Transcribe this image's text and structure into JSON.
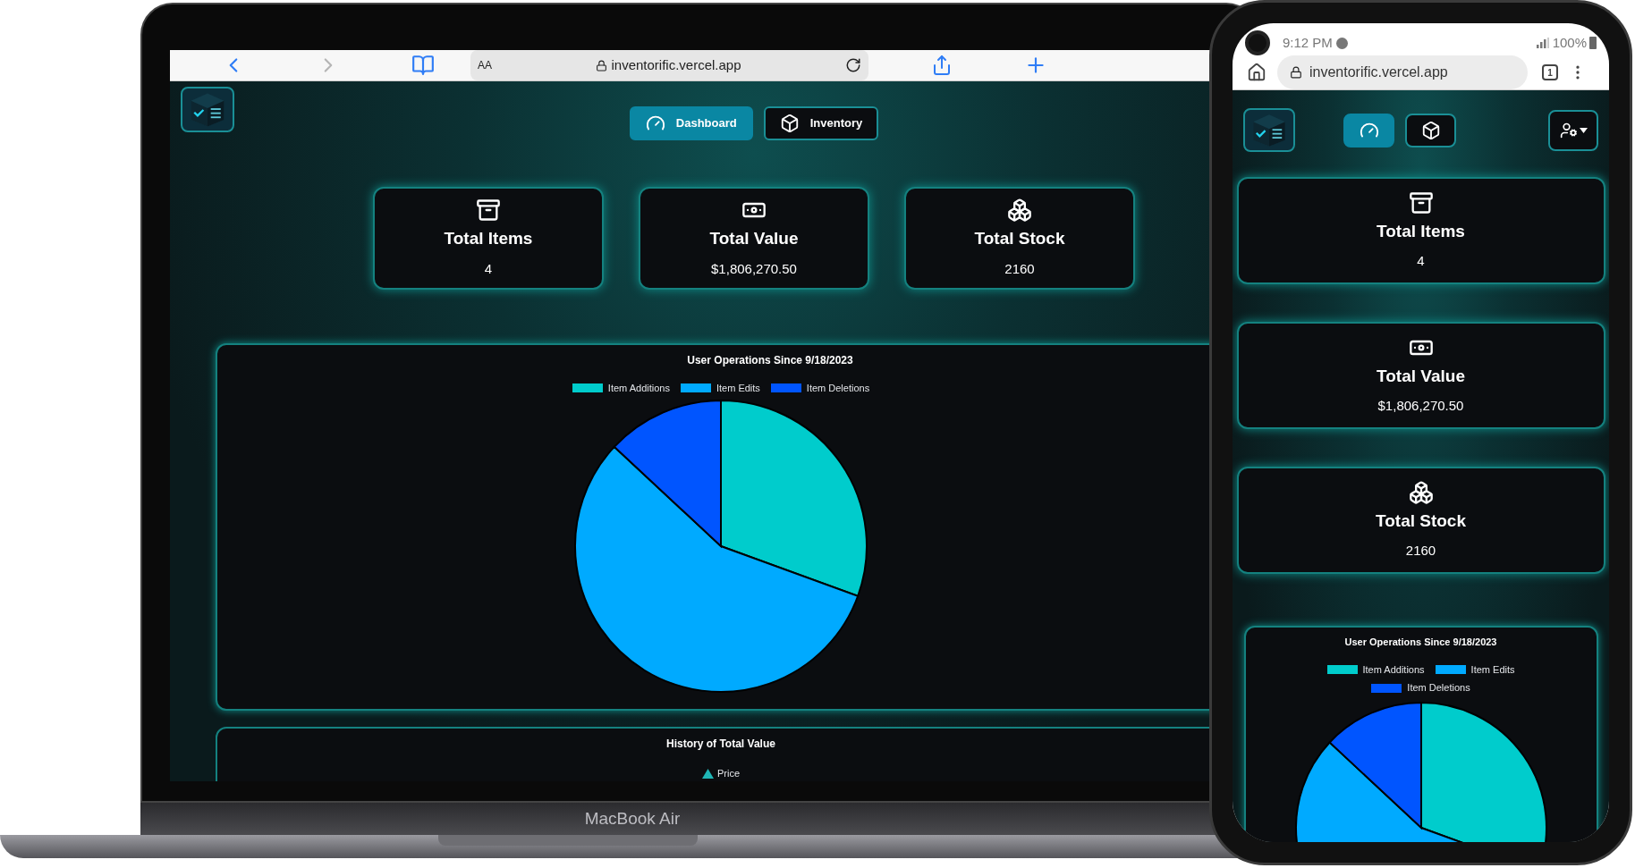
{
  "laptop": {
    "browser": {
      "text_size_button": "AA",
      "url": "inventorific.vercel.app"
    },
    "nav": [
      {
        "kind": "dashboard",
        "label": "Dashboard",
        "selected": true
      },
      {
        "kind": "inventory",
        "label": "Inventory",
        "selected": false
      }
    ],
    "stats": [
      {
        "kind": "items",
        "title": "Total Items",
        "value": "4"
      },
      {
        "kind": "value",
        "title": "Total Value",
        "value": "$1,806,270.50"
      },
      {
        "kind": "stock",
        "title": "Total Stock",
        "value": "2160"
      }
    ],
    "ops_chart": {
      "title": "User Operations Since 9/18/2023",
      "legend": [
        {
          "label": "Item Additions",
          "color": "#00cccc"
        },
        {
          "label": "Item Edits",
          "color": "#00aaff"
        },
        {
          "label": "Item Deletions",
          "color": "#0055ff"
        }
      ]
    },
    "history_chart": {
      "title": "History of Total Value",
      "legend": [
        {
          "label": "Price",
          "color": "#1fb5b5"
        }
      ]
    },
    "device_label": "MacBook Air"
  },
  "phone": {
    "status": {
      "time": "9:12 PM",
      "battery": "100%"
    },
    "browser": {
      "url": "inventorific.vercel.app",
      "tab_count": "1"
    },
    "nav": [
      {
        "kind": "dashboard",
        "selected": true
      },
      {
        "kind": "inventory",
        "selected": false
      }
    ],
    "stats": [
      {
        "kind": "items",
        "title": "Total Items",
        "value": "4"
      },
      {
        "kind": "value",
        "title": "Total Value",
        "value": "$1,806,270.50"
      },
      {
        "kind": "stock",
        "title": "Total Stock",
        "value": "2160"
      }
    ],
    "ops_chart": {
      "title": "User Operations Since 9/18/2023",
      "legend": [
        {
          "label": "Item Additions",
          "color": "#00cccc"
        },
        {
          "label": "Item Edits",
          "color": "#00aaff"
        },
        {
          "label": "Item Deletions",
          "color": "#0055ff"
        }
      ]
    }
  }
}
